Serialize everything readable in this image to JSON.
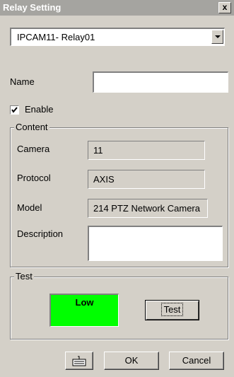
{
  "window": {
    "title": "Relay Setting",
    "close_label": "x"
  },
  "relay_select": {
    "selected": "IPCAM11- Relay01"
  },
  "name": {
    "label": "Name",
    "value": ""
  },
  "enable": {
    "label": "Enable",
    "checked": true
  },
  "content": {
    "legend": "Content",
    "camera": {
      "label": "Camera",
      "value": "11"
    },
    "protocol": {
      "label": "Protocol",
      "value": "AXIS"
    },
    "model": {
      "label": "Model",
      "value": "214 PTZ Network Camera"
    },
    "description": {
      "label": "Description",
      "value": ""
    }
  },
  "test": {
    "legend": "Test",
    "status_text": "Low",
    "status_color": "#00ff00",
    "button_label": "Test"
  },
  "footer": {
    "keyboard_icon": "keyboard-icon",
    "ok_label": "OK",
    "cancel_label": "Cancel"
  }
}
